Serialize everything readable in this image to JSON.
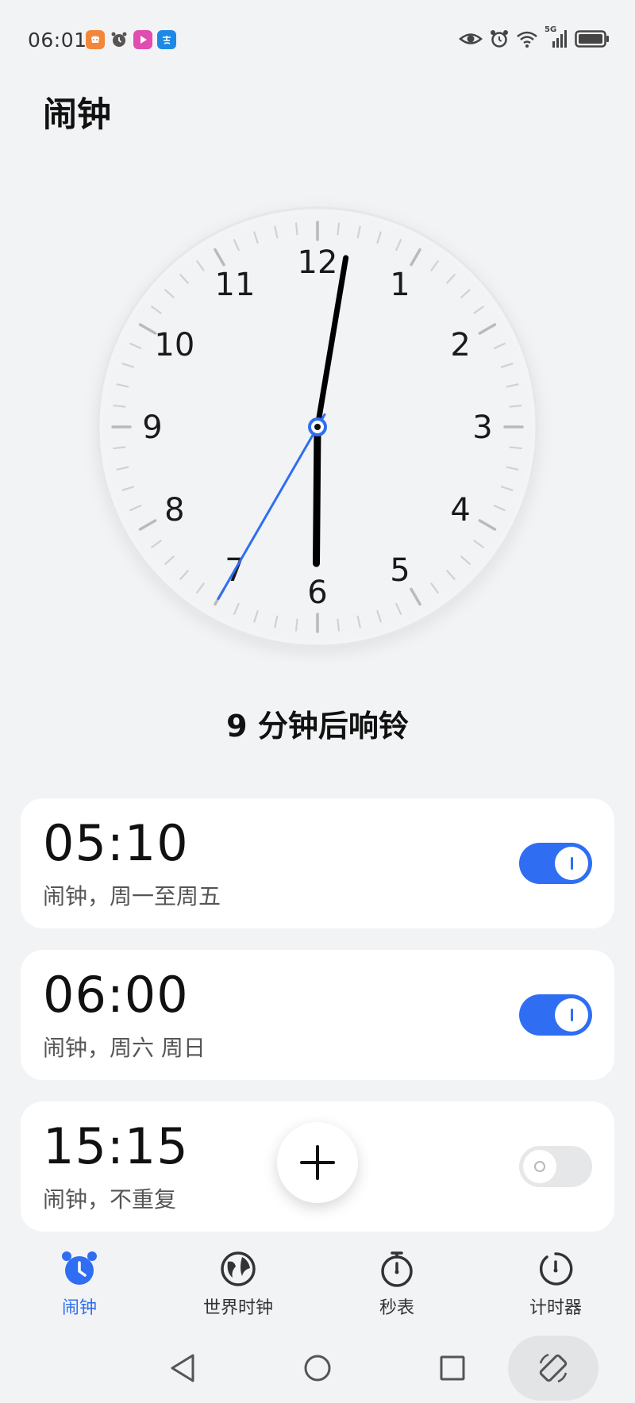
{
  "status_bar": {
    "time": "06:01",
    "network": "5G"
  },
  "header": {
    "title": "闹钟"
  },
  "clock": {
    "numerals": [
      "12",
      "1",
      "2",
      "3",
      "4",
      "5",
      "6",
      "7",
      "8",
      "9",
      "10",
      "11"
    ],
    "hour": 6,
    "minute": 1,
    "second": 35,
    "hand_color": "#000000",
    "second_hand_color": "#2f6ef2"
  },
  "countdown": "9 分钟后响铃",
  "alarms": [
    {
      "time": "05:10",
      "label": "闹钟，周一至周五",
      "enabled": true
    },
    {
      "time": "06:00",
      "label": "闹钟，周六 周日",
      "enabled": true
    },
    {
      "time": "15:15",
      "label": "闹钟，不重复",
      "enabled": false
    }
  ],
  "add_button": {
    "icon": "plus-icon"
  },
  "bottom_nav": [
    {
      "label": "闹钟",
      "icon": "alarm-clock-icon",
      "active": true
    },
    {
      "label": "世界时钟",
      "icon": "globe-icon",
      "active": false
    },
    {
      "label": "秒表",
      "icon": "stopwatch-icon",
      "active": false
    },
    {
      "label": "计时器",
      "icon": "timer-icon",
      "active": false
    }
  ],
  "system_nav": [
    "back-icon",
    "home-icon",
    "recents-icon",
    "rotate-icon"
  ],
  "colors": {
    "accent": "#2f6ef2",
    "background": "#f1f3f5",
    "card": "#ffffff"
  }
}
